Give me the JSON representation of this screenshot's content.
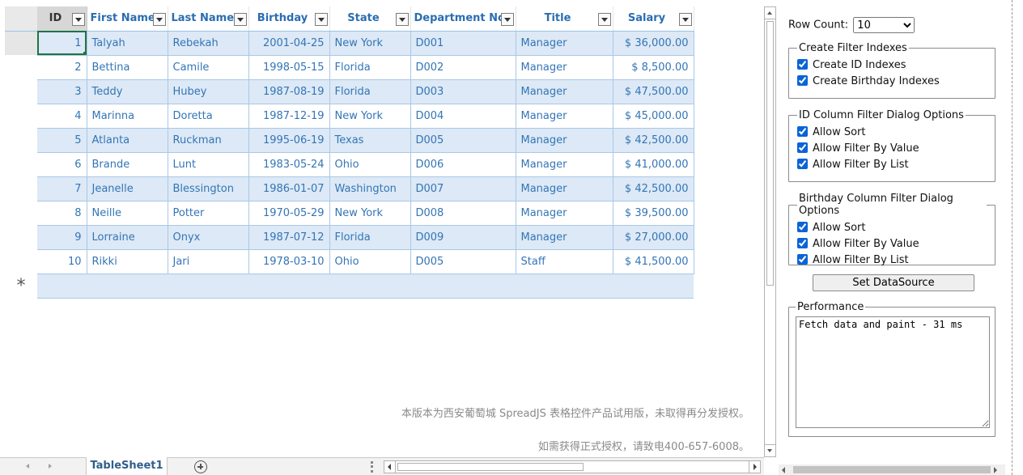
{
  "table": {
    "columns": [
      "ID",
      "First Name",
      "Last Name",
      "Birthday",
      "State",
      "Department No",
      "Title",
      "Salary"
    ],
    "rows": [
      [
        "1",
        "Talyah",
        "Rebekah",
        "2001-04-25",
        "New York",
        "D001",
        "Manager",
        "$ 36,000.00"
      ],
      [
        "2",
        "Bettina",
        "Camile",
        "1998-05-15",
        "Florida",
        "D002",
        "Manager",
        "$ 8,500.00"
      ],
      [
        "3",
        "Teddy",
        "Hubey",
        "1987-08-19",
        "Florida",
        "D003",
        "Manager",
        "$ 47,500.00"
      ],
      [
        "4",
        "Marinna",
        "Doretta",
        "1987-12-19",
        "New York",
        "D004",
        "Manager",
        "$ 45,000.00"
      ],
      [
        "5",
        "Atlanta",
        "Ruckman",
        "1995-06-19",
        "Texas",
        "D005",
        "Manager",
        "$ 42,500.00"
      ],
      [
        "6",
        "Brande",
        "Lunt",
        "1983-05-24",
        "Ohio",
        "D006",
        "Manager",
        "$ 41,000.00"
      ],
      [
        "7",
        "Jeanelle",
        "Blessington",
        "1986-01-07",
        "Washington",
        "D007",
        "Manager",
        "$ 42,500.00"
      ],
      [
        "8",
        "Neille",
        "Potter",
        "1970-05-29",
        "New York",
        "D008",
        "Manager",
        "$ 39,500.00"
      ],
      [
        "9",
        "Lorraine",
        "Onyx",
        "1987-07-12",
        "Florida",
        "D009",
        "Manager",
        "$ 27,000.00"
      ],
      [
        "10",
        "Rikki",
        "Jari",
        "1978-03-10",
        "Ohio",
        "D005",
        "Staff",
        "$ 41,500.00"
      ]
    ],
    "new_row_marker": "*"
  },
  "watermark": {
    "line1": "本版本为西安葡萄城 SpreadJS 表格控件产品试用版，未取得再分发授权。",
    "line2": "如需获得正式授权，请致电400-657-6008。"
  },
  "tabs": {
    "active_sheet": "TableSheet1"
  },
  "panel": {
    "row_count_label": "Row Count:",
    "row_count_value": "10",
    "filter_indexes": {
      "legend": "Create Filter Indexes",
      "options": [
        {
          "label": "Create ID Indexes",
          "checked": true
        },
        {
          "label": "Create Birthday Indexes",
          "checked": true
        }
      ]
    },
    "id_filter": {
      "legend": "ID Column Filter Dialog Options",
      "options": [
        {
          "label": "Allow Sort",
          "checked": true
        },
        {
          "label": "Allow Filter By Value",
          "checked": true
        },
        {
          "label": "Allow Filter By List",
          "checked": true
        }
      ]
    },
    "birthday_filter": {
      "legend": "Birthday Column Filter Dialog Options",
      "options": [
        {
          "label": "Allow Sort",
          "checked": true
        },
        {
          "label": "Allow Filter By Value",
          "checked": true
        },
        {
          "label": "Allow Filter By List",
          "checked": true
        }
      ]
    },
    "set_datasource_label": "Set DataSource",
    "performance": {
      "legend": "Performance",
      "text": "Fetch data and paint - 31 ms"
    }
  },
  "colors": {
    "header_text": "#2a6db1",
    "cell_text": "#3375b6",
    "band_row": "#dde9f6",
    "active_cell_border": "#217346"
  }
}
